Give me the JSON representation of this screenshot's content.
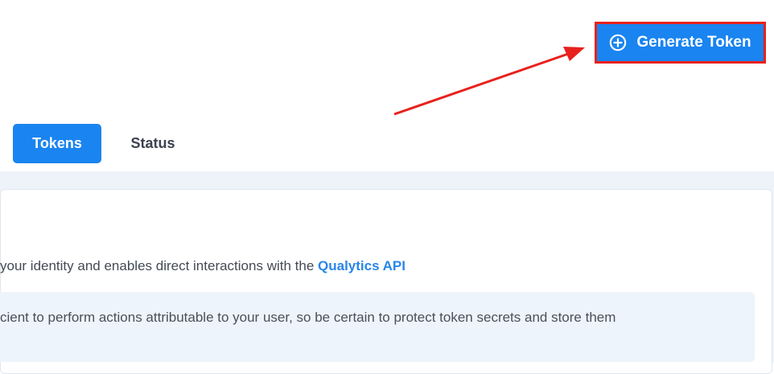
{
  "header": {
    "generate_button_label": "Generate Token",
    "generate_button_icon": "plus-circle-icon"
  },
  "tabs": [
    {
      "label": "Tokens",
      "active": true
    },
    {
      "label": "Status",
      "active": false
    }
  ],
  "card": {
    "description_prefix": "your identity and enables direct interactions with the ",
    "description_link": "Qualytics API",
    "info_text": "cient to perform actions attributable to your user, so be certain to protect token secrets and store them"
  },
  "colors": {
    "primary": "#1a84f0",
    "highlight_border": "#e8211c",
    "link": "#2a86e8",
    "info_bg": "#eef4fb"
  }
}
